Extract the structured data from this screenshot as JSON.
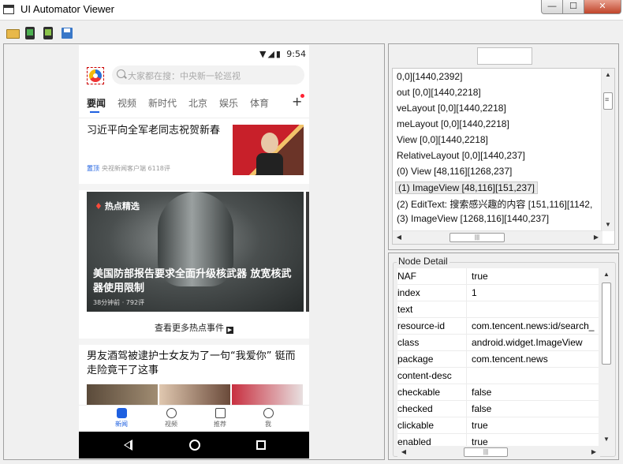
{
  "window": {
    "title": "UI Automator Viewer",
    "min_label": "—",
    "max_label": "☐",
    "close_label": "✕"
  },
  "toolbar": {
    "buttons": [
      "open-icon",
      "device-screenshot-icon",
      "device-screenshot-compressed-icon",
      "save-icon"
    ]
  },
  "phone": {
    "status": {
      "icons": "▼◢▮",
      "time": "9:54"
    },
    "search_placeholder": "大家都在搜：中央新一轮巡视",
    "tabs": [
      "要闻",
      "视频",
      "新时代",
      "北京",
      "娱乐",
      "体育"
    ],
    "tab_add": "+",
    "news1": {
      "title": "习近平向全军老同志祝贺新春",
      "pin": "置顶",
      "meta": "央视新闻客户端  6118评"
    },
    "hot": {
      "tag": "热点精选",
      "title": "美国防部报告要求全面升级核武器 放宽核武器使用限制",
      "meta": "38分钟前 · 792评"
    },
    "more_link": "查看更多热点事件",
    "more_arrow": "▶",
    "news2_title": "男友酒驾被逮护士女友为了一句“我爱你” 铤而走险竟干了这事",
    "bottom_nav": [
      {
        "label": "新闻",
        "icon": "news-icon"
      },
      {
        "label": "视频",
        "icon": "video-icon"
      },
      {
        "label": "推荐",
        "icon": "recommend-icon"
      },
      {
        "label": "我",
        "icon": "me-icon"
      }
    ]
  },
  "tree": {
    "lines": [
      "0,0][1440,2392]",
      "out [0,0][1440,2218]",
      "veLayout [0,0][1440,2218]",
      "meLayout [0,0][1440,2218]",
      "View [0,0][1440,2218]",
      " RelativeLayout [0,0][1440,237]",
      " (0) View [48,116][1268,237]",
      " (1) ImageView [48,116][151,237]",
      " (2) EditText: 搜索感兴趣的内容 [151,116][1142,",
      " (3) ImageView [1268,116][1440,237]",
      "                              [         ]"
    ],
    "selected_index": 7
  },
  "detail": {
    "legend": "Node Detail",
    "rows": [
      {
        "key": "NAF",
        "value": "true"
      },
      {
        "key": "index",
        "value": "1"
      },
      {
        "key": "text",
        "value": ""
      },
      {
        "key": "resource-id",
        "value": "com.tencent.news:id/search_"
      },
      {
        "key": "class",
        "value": "android.widget.ImageView"
      },
      {
        "key": "package",
        "value": "com.tencent.news"
      },
      {
        "key": "content-desc",
        "value": ""
      },
      {
        "key": "checkable",
        "value": "false"
      },
      {
        "key": "checked",
        "value": "false"
      },
      {
        "key": "clickable",
        "value": "true"
      },
      {
        "key": "enabled",
        "value": "true"
      }
    ]
  },
  "scroll": {
    "up": "▲",
    "down": "▼",
    "left": "◀",
    "right": "▶",
    "grip": "|||"
  }
}
